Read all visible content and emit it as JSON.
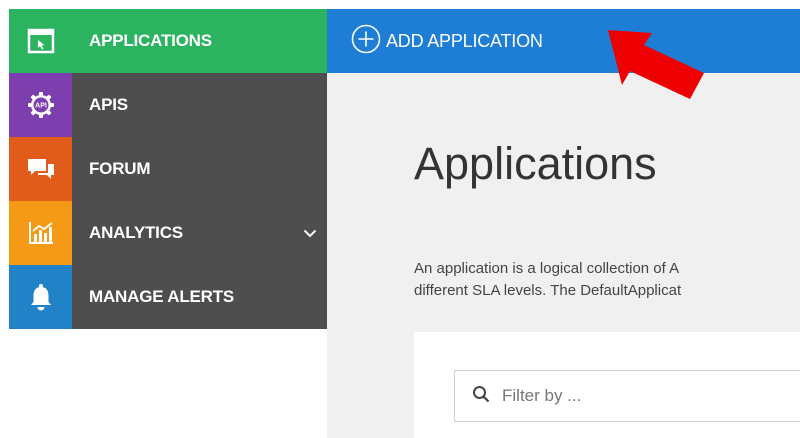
{
  "sidebar": {
    "items": [
      {
        "label": "APPLICATIONS",
        "icon": "application-window-icon",
        "icon_bg": "#2bb35f",
        "active": true
      },
      {
        "label": "APIS",
        "icon": "api-gear-icon",
        "icon_bg": "#7e3fae",
        "active": false
      },
      {
        "label": "FORUM",
        "icon": "chat-bubbles-icon",
        "icon_bg": "#e15b1a",
        "active": false
      },
      {
        "label": "ANALYTICS",
        "icon": "analytics-chart-icon",
        "icon_bg": "#f59a16",
        "active": false,
        "has_chevron": true
      },
      {
        "label": "MANAGE ALERTS",
        "icon": "bell-icon",
        "icon_bg": "#2182c8",
        "active": false
      }
    ]
  },
  "topbar": {
    "add_label": "ADD APPLICATION",
    "bg": "#1e7ed6"
  },
  "main": {
    "title": "Applications",
    "description_line1": "An application is a logical collection of A",
    "description_line2": "different SLA levels. The DefaultApplicat",
    "filter_placeholder": "Filter by ..."
  },
  "colors": {
    "sidebar_bg": "#4e4e4e",
    "active_bg": "#2bb35f",
    "annotation_arrow": "#ee0000"
  }
}
